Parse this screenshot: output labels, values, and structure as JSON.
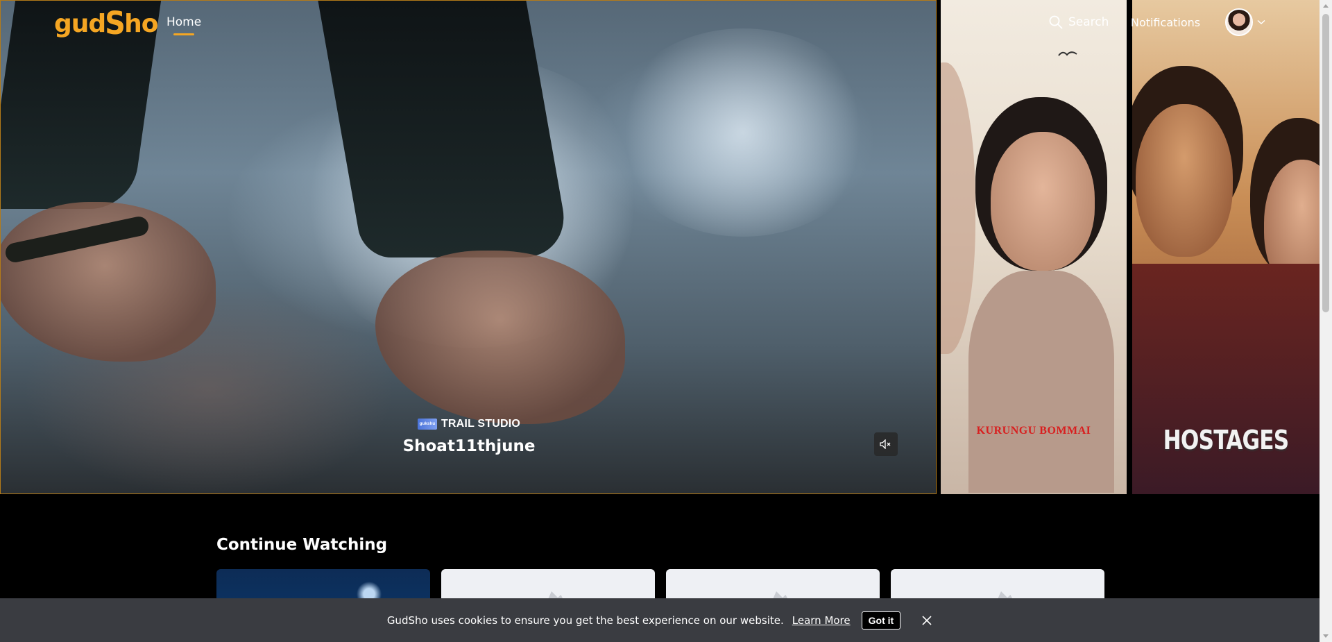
{
  "header": {
    "logo_text_left": "gud",
    "logo_text_s": "S",
    "logo_text_right": "ho",
    "nav_home": "Home",
    "search_label": "Search",
    "notifications_label": "Notifications",
    "accent_color": "#f5a623"
  },
  "hero": {
    "studio_logo_text": "gukshu",
    "studio_name": "TRAIL STUDIO",
    "title": "Shoat11thjune",
    "mute_icon": "speaker-muted-icon"
  },
  "posters": [
    {
      "title": "KURUNGU BOMMAI",
      "title_color": "#d81f1f"
    },
    {
      "title": "HOSTAGES",
      "title_color": "#f2f2f2"
    }
  ],
  "continue_watching": {
    "title": "Continue Watching",
    "cards": [
      "thumbnail",
      "placeholder",
      "placeholder",
      "placeholder"
    ]
  },
  "cookie_bar": {
    "message": "GudSho uses cookies to ensure you get the best experience on our website.",
    "learn_more": "Learn More",
    "accept": "Got it",
    "close_icon": "close-icon",
    "background": "#3a3c41"
  }
}
